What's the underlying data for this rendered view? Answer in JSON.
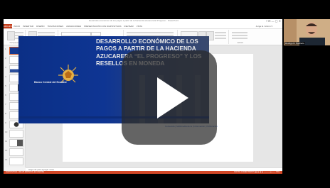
{
  "window": {
    "title": "Desarrollo económico de los pagos a partir de la hacienda azucarera El Progreso - PowerPoint",
    "controls": "? ⊡ — ▢ ✕"
  },
  "ribbon": {
    "file_tab": "ARCHIVO",
    "tabs": [
      "INICIO",
      "INSERTAR",
      "DISEÑO",
      "TRANSICIONES",
      "ANIMACIONES",
      "PRESENTACIÓN CON DIAPOSITIVAS",
      "REVISAR",
      "VISTA"
    ],
    "user": "Jorge E. Grimm ▾",
    "groups": [
      "Portapapeles",
      "Diapositivas",
      "Fuente",
      "Párrafo",
      "Dibujo",
      "Edición"
    ]
  },
  "thumbnails": [
    "1",
    "2",
    "3",
    "4",
    "5",
    "6",
    "7",
    "8",
    "9",
    "10",
    "11",
    "12",
    "13"
  ],
  "slide": {
    "headline": "DESARROLLO ECONÓMICO DE LOS PAGOS A PARTIR DE LA HACIENDA AZUCARERA “EL PROGRESO” Y LOS RESELLOS EN MONEDA",
    "logo_text": "Banco Central del Ecuador",
    "footer_links": "Contenido | Multimedia de la | Información | Publicación"
  },
  "notes_placeholder": "Haga clic para agregar notas",
  "status": {
    "left": "DIAPOSITIVA 1 DE 25    ESPAÑOL (ECUADOR)",
    "right": "NOTAS   COMENTARIOS   ▣  ▥  ▤  ▶   ─────●───  74%"
  },
  "webcam": {
    "name": "Rodrigo D. Pacheco"
  },
  "colors": {
    "accent": "#d24726",
    "banner": "#0e3593"
  }
}
